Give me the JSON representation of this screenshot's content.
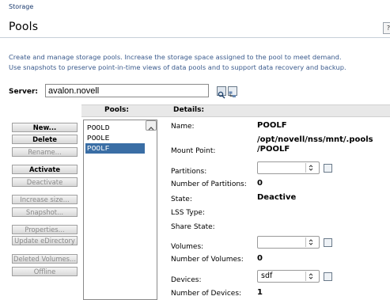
{
  "breadcrumb": "Storage",
  "page_title": "Pools",
  "description": [
    "Create and manage storage pools. Increase the storage space assigned to the pool to meet demand.",
    "Use snapshots to preserve point-in-time views of data pools and to support data recovery and backup."
  ],
  "server": {
    "label": "Server:",
    "value": "avalon.novell"
  },
  "headers": {
    "pools": "Pools:",
    "details": "Details:"
  },
  "buttons": [
    {
      "label": "New...",
      "enabled": true
    },
    {
      "label": "Delete",
      "enabled": true
    },
    {
      "label": "Rename...",
      "enabled": false
    },
    {
      "label": "Activate",
      "enabled": true
    },
    {
      "label": "Deactivate",
      "enabled": false
    },
    {
      "label": "Increase size...",
      "enabled": false
    },
    {
      "label": "Snapshot...",
      "enabled": false
    },
    {
      "label": "Properties...",
      "enabled": false
    },
    {
      "label": "Update eDirectory",
      "enabled": false
    },
    {
      "label": "Deleted Volumes...",
      "enabled": false
    },
    {
      "label": "Offline",
      "enabled": false
    }
  ],
  "pools": [
    "POOLD",
    "POOLE",
    "POOLF"
  ],
  "selected_pool": "POOLF",
  "details": {
    "name_label": "Name:",
    "name_value": "POOLF",
    "mount_label": "Mount Point:",
    "mount_value_line1": "/opt/novell/nss/mnt/.pools",
    "mount_value_line2": "/POOLF",
    "partitions_label": "Partitions:",
    "partitions_selected": "",
    "num_partitions_label": "Number of Partitions:",
    "num_partitions_value": "0",
    "state_label": "State:",
    "state_value": "Deactive",
    "lss_label": "LSS Type:",
    "share_label": "Share State:",
    "volumes_label": "Volumes:",
    "volumes_selected": "",
    "num_volumes_label": "Number of Volumes:",
    "num_volumes_value": "0",
    "devices_label": "Devices:",
    "devices_selected": "sdf",
    "num_devices_label": "Number of Devices:",
    "num_devices_value": "1"
  },
  "colors": {
    "selection": "#3a6ea5",
    "description_text": "#3a5a8c"
  },
  "icons": {
    "search": "search-icon",
    "browse": "browse-tree-icon",
    "properties": "properties-icon",
    "scroll_up": "chevron-up-icon",
    "dropdown": "chevron-updown-icon",
    "help": "help-icon"
  }
}
